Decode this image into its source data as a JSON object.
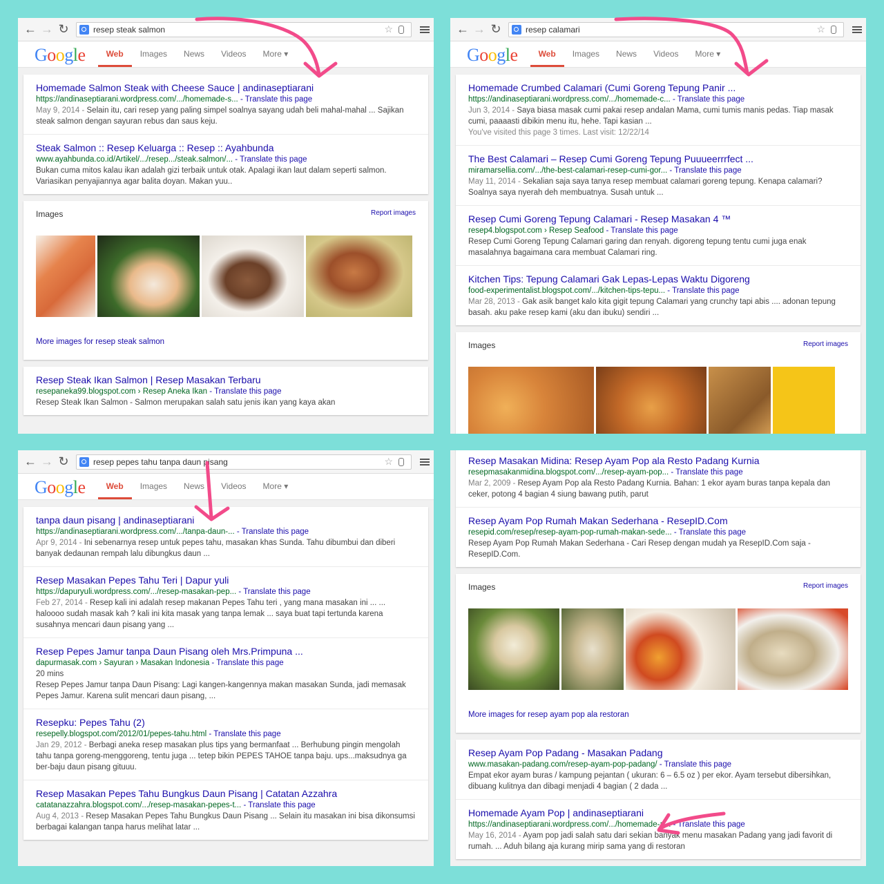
{
  "colors": {
    "background": "#7ddfd9",
    "link": "#1a0dab",
    "url": "#006621",
    "active_tab": "#dd4b39",
    "arrow": "#f24b8a"
  },
  "google_tabs": [
    "Web",
    "Images",
    "News",
    "Videos",
    "More ▾"
  ],
  "p1": {
    "query": "resep steak salmon",
    "results": [
      {
        "title": "Homemade Salmon Steak with Cheese Sauce | andinaseptiarani",
        "url": "https://andinaseptiarani.wordpress.com/.../homemade-s...",
        "translate": "- Translate this page",
        "date": "May 9, 2014 - ",
        "snippet": "Selain itu, cari resep yang paling simpel soalnya sayang udah beli mahal-mahal ... Sajikan steak salmon dengan sayuran rebus dan saus keju."
      },
      {
        "title": "Steak Salmon :: Resep Keluarga :: Resep :: Ayahbunda",
        "url": "www.ayahbunda.co.id/Artikel/.../resep.../steak.salmon/...",
        "translate": "- Translate this page",
        "date": "",
        "snippet": "Bukan cuma mitos kalau ikan adalah gizi terbaik untuk otak. Apalagi ikan laut dalam seperti salmon. Variasikan penyajiannya agar balita doyan. Makan yuu.."
      }
    ],
    "images": {
      "label": "Images",
      "report": "Report images",
      "more": "More images for resep steak salmon"
    },
    "extra": {
      "title": "Resep Steak Ikan Salmon | Resep Masakan Terbaru",
      "url": "resepaneka99.blogspot.com › Resep Aneka Ikan",
      "translate": "- Translate this page",
      "snippet": "Resep Steak Ikan Salmon - Salmon merupakan salah satu jenis ikan yang kaya akan"
    }
  },
  "p2": {
    "query": "resep calamari",
    "results": [
      {
        "title": "Homemade Crumbed Calamari (Cumi Goreng Tepung Panir ...",
        "url": "https://andinaseptiarani.wordpress.com/.../homemade-c...",
        "translate": "- Translate this page",
        "date": "Jun 3, 2014 - ",
        "snippet": "Saya biasa masak cumi pakai resep andalan Mama, cumi tumis manis pedas. Tiap masak cumi, paaaasti dibikin menu itu, hehe. Tapi kasian ...",
        "visit": "You've visited this page 3 times. Last visit: 12/22/14"
      },
      {
        "title": "The Best Calamari – Resep Cumi Goreng Tepung Puuueerrrfect ...",
        "url": "miramarsellia.com/.../the-best-calamari-resep-cumi-gor...",
        "translate": "- Translate this page",
        "date": "May 11, 2014 - ",
        "snippet": "Sekalian saja saya tanya resep membuat calamari goreng tepung. Kenapa calamari? Soalnya saya nyerah deh membuatnya. Susah untuk ..."
      },
      {
        "title": "Resep Cumi Goreng Tepung Calamari - Resep Masakan 4 ™",
        "url": "resep4.blogspot.com › Resep Seafood",
        "translate": "- Translate this page",
        "date": "",
        "snippet": "Resep Cumi Goreng Tepung Calamari garing dan renyah. digoreng tepung tentu cumi juga enak masalahnya bagaimana cara membuat Calamari ring."
      },
      {
        "title": "Kitchen Tips: Tepung Calamari Gak Lepas-Lepas Waktu Digoreng",
        "url": "food-experimentalist.blogspot.com/.../kitchen-tips-tepu...",
        "translate": "- Translate this page",
        "date": "Mar 28, 2013 - ",
        "snippet": "Gak asik banget kalo kita gigit tepung Calamari yang crunchy tapi abis .... adonan tepung basah. aku pake resep kami (aku dan ibuku) sendiri ..."
      }
    ],
    "images": {
      "label": "Images",
      "report": "Report images"
    }
  },
  "p3": {
    "query": "resep pepes tahu tanpa daun pisang",
    "results": [
      {
        "title": "tanpa daun pisang | andinaseptiarani",
        "url": "https://andinaseptiarani.wordpress.com/.../tanpa-daun-...",
        "translate": "- Translate this page",
        "date": "Apr 9, 2014 - ",
        "snippet": "Ini sebenarnya resep untuk pepes tahu, masakan khas Sunda. Tahu dibumbui dan diberi banyak dedaunan rempah lalu dibungkus daun ..."
      },
      {
        "title": "Resep Masakan Pepes Tahu Teri | Dapur yuli",
        "url": "https://dapuryuli.wordpress.com/.../resep-masakan-pep...",
        "translate": "- Translate this page",
        "date": "Feb 27, 2014 - ",
        "snippet": "Resep kali ini adalah resep makanan Pepes Tahu teri , yang mana masakan ini ... ... haloooo sudah masak kah ? kali ini kita masak yang tanpa lemak ... saya buat tapi tertunda karena susahnya mencari daun pisang yang ..."
      },
      {
        "title": "Resep Pepes Jamur tanpa Daun Pisang oleh Mrs.Primpuna ...",
        "url": "dapurmasak.com › Sayuran › Masakan Indonesia",
        "translate": "- Translate this page",
        "date": "20 mins",
        "snippet": "Resep Pepes Jamur tanpa Daun Pisang: Lagi kangen-kangennya makan masakan Sunda, jadi memasak Pepes Jamur. Karena sulit mencari daun pisang, ..."
      },
      {
        "title": "Resepku: Pepes Tahu (2)",
        "url": "resepelly.blogspot.com/2012/01/pepes-tahu.html",
        "translate": "- Translate this page",
        "date": "Jan 29, 2012 - ",
        "snippet": "Berbagi aneka resep masakan plus tips yang bermanfaat ... Berhubung pingin mengolah tahu tanpa goreng-menggoreng, tentu juga ... tetep bikin PEPES TAHOE tanpa baju. ups...maksudnya ga ber-baju daun pisang gituuu."
      },
      {
        "title": "Resep Masakan Pepes Tahu Bungkus Daun Pisang | Catatan Azzahra",
        "url": "catatanazzahra.blogspot.com/.../resep-masakan-pepes-t...",
        "translate": "- Translate this page",
        "date": "Aug 4, 2013 - ",
        "snippet": "Resep Masakan Pepes Tahu Bungkus Daun Pisang ... Selain itu masakan ini bisa dikonsumsi berbagai kalangan tanpa harus melihat latar ..."
      }
    ]
  },
  "p4": {
    "results": [
      {
        "title": "Resep Masakan Midina: Resep Ayam Pop ala Resto Padang Kurnia",
        "url": "resepmasakanmidina.blogspot.com/.../resep-ayam-pop...",
        "translate": "- Translate this page",
        "date": "Mar 2, 2009 - ",
        "snippet": "Resep Ayam Pop ala Resto Padang Kurnia. Bahan: 1 ekor ayam buras tanpa kepala dan ceker, potong 4 bagian 4 siung bawang putih, parut"
      },
      {
        "title": "Resep Ayam Pop Rumah Makan Sederhana - ResepID.Com",
        "url": "resepid.com/resep/resep-ayam-pop-rumah-makan-sede...",
        "translate": "- Translate this page",
        "date": "",
        "snippet": "Resep Ayam Pop Rumah Makan Sederhana - Cari Resep dengan mudah ya ResepID.Com saja - ResepID.Com."
      }
    ],
    "images": {
      "label": "Images",
      "report": "Report images",
      "more": "More images for resep ayam pop ala restoran"
    },
    "results2": [
      {
        "title": "Resep Ayam Pop Padang - Masakan Padang",
        "url": "www.masakan-padang.com/resep-ayam-pop-padang/",
        "translate": "- Translate this page",
        "date": "",
        "snippet": "Empat ekor ayam buras / kampung pejantan ( ukuran: 6 – 6.5 oz ) per ekor. Ayam tersebut dibersihkan, dibuang kulitnya dan dibagi menjadi 4 bagian ( 2 dada ..."
      },
      {
        "title": "Homemade Ayam Pop | andinaseptiarani",
        "url": "https://andinaseptiarani.wordpress.com/.../homemade-a...",
        "translate": "- Translate this page",
        "date": "May 16, 2014 - ",
        "snippet": "Ayam pop jadi salah satu dari sekian banyak menu masakan Padang yang jadi favorit di rumah. ... Aduh bilang aja kurang mirip sama yang di restoran"
      }
    ]
  }
}
